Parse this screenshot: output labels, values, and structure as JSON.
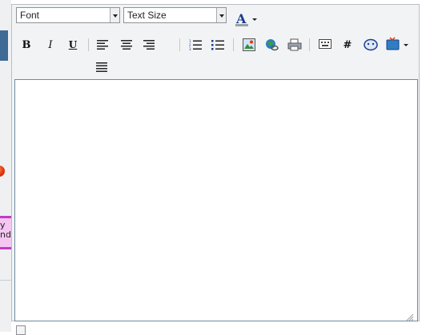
{
  "toolbar": {
    "font_select": {
      "selected": "Font"
    },
    "size_select": {
      "selected": "Text Size"
    },
    "icons": {
      "text_color": "text-color-icon",
      "bold": "bold-icon",
      "italic": "italic-icon",
      "underline": "underline-icon",
      "align_left": "align-left-icon",
      "align_center": "align-center-icon",
      "align_right": "align-right-icon",
      "justify": "justify-icon",
      "ordered_list": "ordered-list-icon",
      "unordered_list": "unordered-list-icon",
      "insert_image": "insert-image-icon",
      "insert_link": "insert-link-icon",
      "print": "print-icon",
      "keyboard": "keyboard-icon",
      "hashtag": "hashtag-icon",
      "smiley": "smiley-icon",
      "media": "media-icon"
    },
    "bold_glyph": "B",
    "italic_glyph": "I",
    "underline_glyph": "U",
    "hash_glyph": "#"
  },
  "left_fragment": {
    "pink_text": "y\nnd u"
  },
  "editor": {
    "content": ""
  },
  "colors": {
    "accent_blue": "#3f6a95",
    "pink": "#f5c6f2",
    "magenta": "#c03cc4",
    "orange": "#e2360b"
  }
}
